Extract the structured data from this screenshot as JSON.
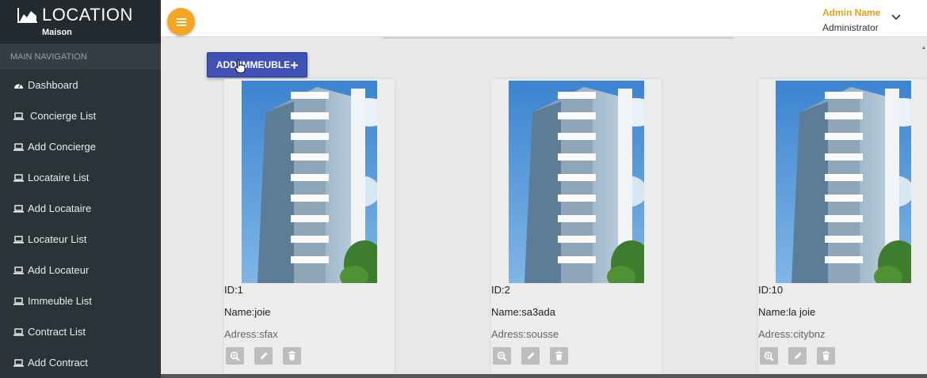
{
  "brand": {
    "title": "LOCATION",
    "subtitle": "Maison"
  },
  "nav": {
    "header": "MAIN NAVIGATION",
    "items": [
      {
        "label": "Dashboard",
        "icon": "dashboard-icon"
      },
      {
        "label": "Concierge List",
        "icon": "laptop-icon"
      },
      {
        "label": "Add Concierge",
        "icon": "laptop-icon"
      },
      {
        "label": "Locataire List",
        "icon": "laptop-icon"
      },
      {
        "label": "Add Locataire",
        "icon": "laptop-icon"
      },
      {
        "label": "Locateur List",
        "icon": "laptop-icon"
      },
      {
        "label": "Add Locateur",
        "icon": "laptop-icon"
      },
      {
        "label": "Immeuble List",
        "icon": "laptop-icon"
      },
      {
        "label": "Contract List",
        "icon": "laptop-icon"
      },
      {
        "label": "Add Contract",
        "icon": "laptop-icon"
      }
    ]
  },
  "topbar": {
    "user_name": "Admin Name",
    "user_role": "Administrator"
  },
  "main": {
    "add_button_label": "ADD IMMEUBLE",
    "cards": [
      {
        "id": "ID:1",
        "name": "Name:joie",
        "address": "Adress:sfax"
      },
      {
        "id": "ID:2",
        "name": "Name:sa3ada",
        "address": "Adress:sousse"
      },
      {
        "id": "ID:10",
        "name": "Name:la joie",
        "address": "Adress:citybnz"
      }
    ]
  },
  "colors": {
    "sidebar": "#2a3338",
    "accent": "#f5a623",
    "primary": "#3f51b5",
    "user_name": "#e8a015"
  }
}
